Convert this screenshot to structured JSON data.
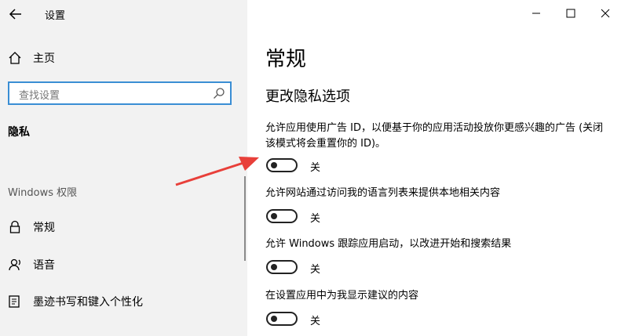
{
  "window": {
    "title": "设置"
  },
  "sidebar": {
    "home_label": "主页",
    "search_placeholder": "查找设置",
    "section_header": "隐私",
    "group_label": "Windows 权限",
    "items": [
      {
        "label": "常规",
        "icon": "lock-icon"
      },
      {
        "label": "语音",
        "icon": "speech-icon"
      },
      {
        "label": "墨迹书写和键入个性化",
        "icon": "pen-keyboard-icon"
      }
    ]
  },
  "main": {
    "title": "常规",
    "subtitle": "更改隐私选项",
    "options": [
      {
        "desc": "允许应用使用广告 ID，以便基于你的应用活动投放你更感兴趣的广告 (关闭该模式将会重置你的 ID)。",
        "state": "关",
        "on": false
      },
      {
        "desc": "允许网站通过访问我的语言列表来提供本地相关内容",
        "state": "关",
        "on": false
      },
      {
        "desc": "允许 Windows 跟踪应用启动，以改进开始和搜索结果",
        "state": "关",
        "on": false
      },
      {
        "desc": "在设置应用中为我显示建议的内容",
        "state": "关",
        "on": false
      }
    ]
  },
  "colors": {
    "accent": "#3a8ed4",
    "arrow": "#e8403a",
    "sidebar_bg": "#f2f2f2"
  }
}
